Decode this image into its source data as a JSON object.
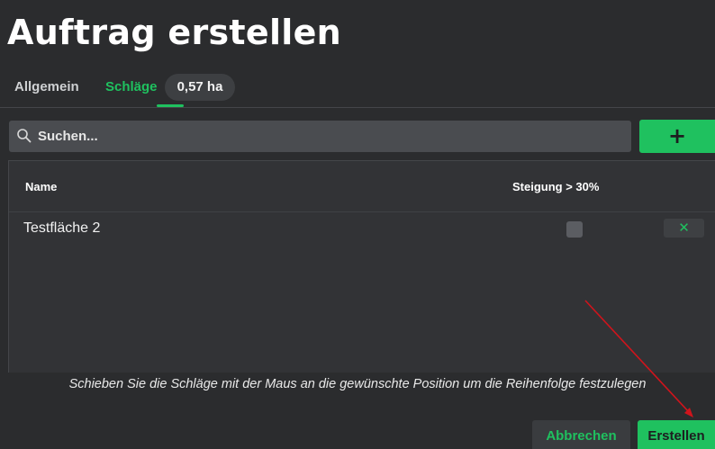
{
  "page": {
    "title": "Auftrag erstellen"
  },
  "tabs": {
    "general": "Allgemein",
    "plots": "Schläge",
    "area_badge": "0,57 ha"
  },
  "search": {
    "placeholder": "Suchen...",
    "value": "",
    "add_label": "+"
  },
  "table": {
    "columns": {
      "name": "Name",
      "slope": "Steigung > 30%"
    },
    "rows": [
      {
        "name": "Testfläche 2",
        "slope_over_30": false,
        "remove_label": "✕"
      }
    ]
  },
  "hint": "Schieben Sie die Schläge mit der Maus an die gewünschte Position um die Reihenfolge festzulegen",
  "footer": {
    "cancel_label": "Abbrechen",
    "create_label": "Erstellen"
  },
  "colors": {
    "background": "#2b2c2e",
    "accent": "#1fc15f",
    "annotation_arrow": "#d0141c"
  },
  "icons": {
    "search": "search-icon",
    "add": "plus-icon",
    "remove": "close-icon"
  }
}
